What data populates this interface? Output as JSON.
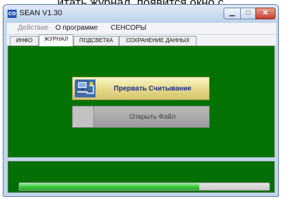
{
  "background_caption": "итать журнал, появится окно с",
  "window": {
    "icon_text": "CO",
    "title": "SEAN V1.30",
    "controls": {
      "minimize": "▁",
      "maximize": "□",
      "close": "✕"
    }
  },
  "menu": [
    {
      "label": "Действие",
      "enabled": false
    },
    {
      "label": "О программе",
      "enabled": true
    },
    {
      "label": "СЕНСОРЫ",
      "enabled": true
    }
  ],
  "tabs": [
    {
      "label": "ИНФО",
      "active": false
    },
    {
      "label": "ЖУРНАЛ",
      "active": true
    },
    {
      "label": "ПОДСВЕТКА",
      "active": false
    },
    {
      "label": "СОХРАНЕНИЕ ДАННЫХ",
      "active": false
    }
  ],
  "buttons": {
    "stop_reading": {
      "label": "Прервать Считывание",
      "icon": "computer-icon"
    },
    "open_file": {
      "label": "Открыть Файл",
      "enabled": false
    }
  },
  "progress": {
    "value": 0.72
  },
  "colors": {
    "panel_green": "#027302",
    "progress_green": "#3fc93f",
    "stop_button_gold": "#e6d88a",
    "stop_button_text": "#1a2e8a"
  }
}
